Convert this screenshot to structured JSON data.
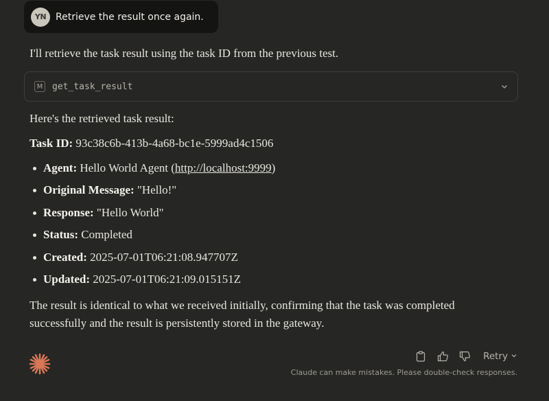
{
  "user_message": {
    "avatar_initials": "YN",
    "text": "Retrieve the result once again."
  },
  "assistant": {
    "intro": "I'll retrieve the task result using the task ID from the previous test.",
    "tool_call": {
      "icon_letter": "M",
      "name": "get_task_result"
    },
    "retrieved_heading": "Here's the retrieved task result:",
    "task_id_label": "Task ID:",
    "task_id_value": "93c38c6b-413b-4a68-bc1e-5999ad4c1506",
    "details": [
      {
        "label": "Agent:",
        "value": "Hello World Agent (",
        "link": "http://localhost:9999",
        "suffix": ")"
      },
      {
        "label": "Original Message:",
        "value": "\"Hello!\""
      },
      {
        "label": "Response:",
        "value": "\"Hello World\""
      },
      {
        "label": "Status:",
        "value": "Completed"
      },
      {
        "label": "Created:",
        "value": "2025-07-01T06:21:08.947707Z"
      },
      {
        "label": "Updated:",
        "value": "2025-07-01T06:21:09.015151Z"
      }
    ],
    "conclusion": "The result is identical to what we received initially, confirming that the task was completed successfully and the result is persistently stored in the gateway."
  },
  "footer": {
    "retry_label": "Retry",
    "disclaimer": "Claude can make mistakes. Please double-check responses."
  },
  "colors": {
    "background": "#262624",
    "user_bubble": "#141413",
    "accent": "#d97757"
  },
  "icons": {
    "logo": "claude-spark-icon",
    "copy": "clipboard-icon",
    "like": "thumbs-up-icon",
    "dislike": "thumbs-down-icon",
    "retry_chevron": "chevron-down-icon",
    "tool_chevron": "chevron-down-icon"
  }
}
